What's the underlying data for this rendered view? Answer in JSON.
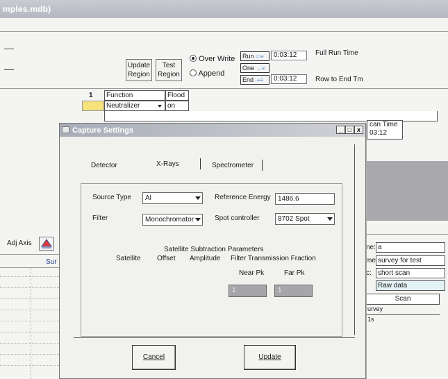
{
  "main": {
    "title": "mples.mdb)",
    "update_region": [
      "Update",
      "Region"
    ],
    "test_region": [
      "Test",
      "Region"
    ],
    "overwrite_label": "Over Write",
    "append_label": "Append",
    "run_label": "Run",
    "one_label": "One",
    "end_label": "End",
    "run_time_value": "0:03:12",
    "end_time_value": "0:03:12",
    "full_run_time_label": "Full Run Time",
    "row_to_end_label": "Row to End Tm",
    "grid": {
      "row_number": "1",
      "col_function": "Function",
      "col_flood": "Flood",
      "cell_function": "Neutralizer",
      "cell_flood": "on"
    },
    "scan_time_label": "can Time",
    "scan_time_value": "03:12",
    "adj_axis_label": "Adj Axis",
    "sur_label": "Sur"
  },
  "right_panel": {
    "label1": "ne:",
    "value1": "a",
    "label2": "me:",
    "value2": "survey for test",
    "label3": "c:",
    "value3": "short scan",
    "value4": "Raw data",
    "scan_header": "Scan",
    "row1": "urvey",
    "row2": "1s"
  },
  "dialog": {
    "title": "Capture Settings",
    "tabs": [
      "Detector",
      "X-Rays",
      "Spectrometer"
    ],
    "source_type_label": "Source Type",
    "source_type_value": "Al",
    "reference_energy_label": "Reference Energy",
    "reference_energy_value": "1486.6",
    "filter_label": "Filter",
    "filter_value": "Monochromator",
    "spot_controller_label": "Spot controller",
    "spot_controller_value": "8702 Spot",
    "satellite_title": "Satellite Subtraction Parameters",
    "col_satellite": "Satellite",
    "col_offset": "Offset",
    "col_amplitude": "Amplitude",
    "col_filter_trans": "Filter Transmission Fraction",
    "near_pk_label": "Near Pk",
    "far_pk_label": "Far Pk",
    "near_pk_value": "1",
    "far_pk_value": "1",
    "cancel_label": "Cancel",
    "update_label": "Update",
    "win_min": "_",
    "win_max": "□",
    "win_close": "x"
  }
}
